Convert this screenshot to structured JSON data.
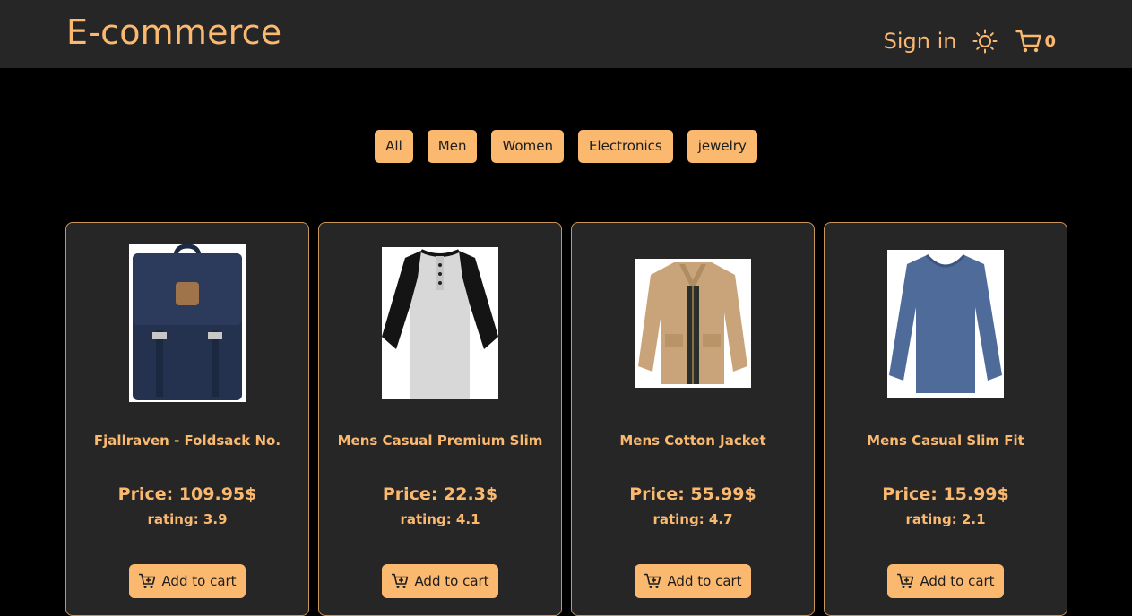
{
  "colors": {
    "accent": "#fbb970",
    "navbar_bg": "#262626",
    "page_bg": "#000000",
    "card_bg": "#262626",
    "card_border": "#c9955a"
  },
  "navbar": {
    "brand": "E-commerce",
    "signin_label": "Sign in",
    "theme_icon": "sun-icon",
    "cart_icon": "shopping-cart-icon",
    "cart_count": "0"
  },
  "filters": [
    {
      "label": "All"
    },
    {
      "label": "Men"
    },
    {
      "label": "Women"
    },
    {
      "label": "Electronics"
    },
    {
      "label": "jewelry"
    }
  ],
  "products": [
    {
      "title": "Fjallraven - Foldsack No.",
      "price": "Price: 109.95$",
      "rating": "rating: 3.9",
      "image": "backpack-image",
      "add_label": "Add to cart"
    },
    {
      "title": "Mens Casual Premium Slim",
      "price": "Price: 22.3$",
      "rating": "rating: 4.1",
      "image": "raglan-tshirt-image",
      "add_label": "Add to cart"
    },
    {
      "title": "Mens Cotton Jacket",
      "price": "Price: 55.99$",
      "rating": "rating: 4.7",
      "image": "cotton-jacket-image",
      "add_label": "Add to cart"
    },
    {
      "title": "Mens Casual Slim Fit",
      "price": "Price: 15.99$",
      "rating": "rating: 2.1",
      "image": "long-sleeve-shirt-image",
      "add_label": "Add to cart"
    }
  ]
}
